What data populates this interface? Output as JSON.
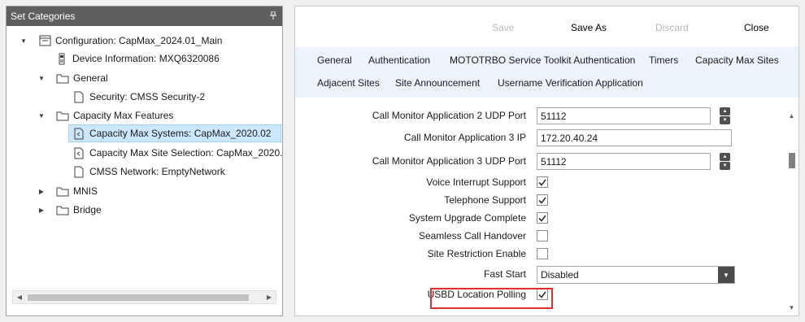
{
  "left": {
    "title": "Set Categories",
    "pin_icon": "pin-icon",
    "tree": [
      {
        "label": "Configuration: CapMax_2024.01_Main",
        "icon": "config-icon",
        "expanded": true
      },
      {
        "label": "Device Information: MXQ6320086",
        "icon": "device-icon"
      },
      {
        "label": "General",
        "icon": "folder-icon",
        "expanded": true
      },
      {
        "label": "Security: CMSS Security-2",
        "icon": "document-icon"
      },
      {
        "label": "Capacity Max Features",
        "icon": "folder-icon",
        "expanded": true
      },
      {
        "label": "Capacity Max Systems: CapMax_2020.02",
        "icon": "link-document-icon",
        "selected": true
      },
      {
        "label": "Capacity Max Site Selection: CapMax_2020.",
        "icon": "link-document-icon"
      },
      {
        "label": "CMSS Network: EmptyNetwork",
        "icon": "document-icon"
      },
      {
        "label": "MNIS",
        "icon": "folder-icon",
        "expanded": false
      },
      {
        "label": "Bridge",
        "icon": "folder-icon",
        "expanded": false
      }
    ]
  },
  "toolbar": {
    "save_label": "Save",
    "save_as_label": "Save As",
    "discard_label": "Discard",
    "close_label": "Close"
  },
  "tabs": [
    "General",
    "Authentication",
    "MOTOTRBO Service Toolkit Authentication",
    "Timers",
    "Capacity Max Sites",
    "Adjacent Sites",
    "Site Announcement",
    "Username Verification Application"
  ],
  "form": {
    "cma2_udp_port_label": "Call Monitor Application 2 UDP Port",
    "cma2_udp_port_value": "51112",
    "cma3_ip_label": "Call Monitor Application 3 IP",
    "cma3_ip_value": "172.20.40.24",
    "cma3_udp_port_label": "Call Monitor Application 3 UDP Port",
    "cma3_udp_port_value": "51112",
    "voice_interrupt_label": "Voice Interrupt Support",
    "voice_interrupt_checked": true,
    "telephone_label": "Telephone Support",
    "telephone_checked": true,
    "system_upgrade_label": "System Upgrade Complete",
    "system_upgrade_checked": true,
    "seamless_label": "Seamless Call Handover",
    "seamless_checked": false,
    "site_restriction_label": "Site Restriction Enable",
    "site_restriction_checked": false,
    "fast_start_label": "Fast Start",
    "fast_start_value": "Disabled",
    "usbd_label": "USBD Location Polling",
    "usbd_checked": true
  },
  "colors": {
    "header_bg": "#5f5f5f",
    "selected_bg": "#cce8ff",
    "highlight_border": "#e0302a",
    "tabs_bg": "#eef4fb"
  }
}
